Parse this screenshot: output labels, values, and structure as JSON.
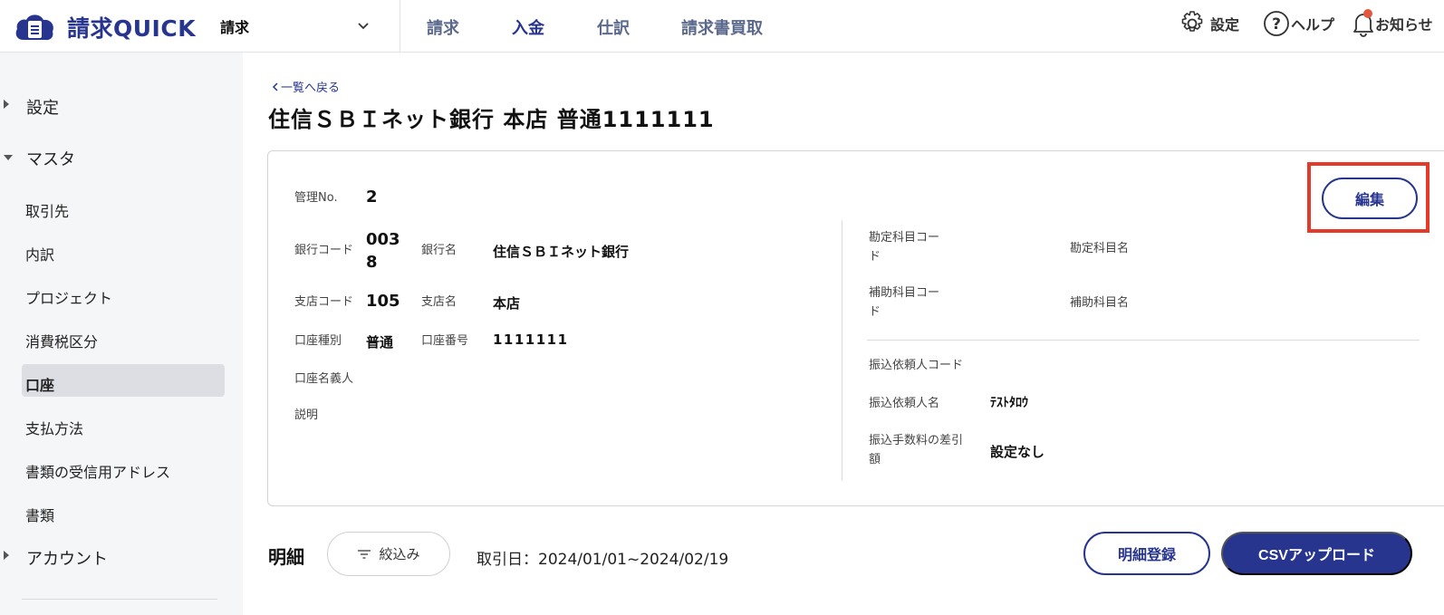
{
  "header": {
    "logo_text": "請求QUICK",
    "app_select": "請求",
    "nav": [
      {
        "label": "請求",
        "active": false
      },
      {
        "label": "入金",
        "active": true
      },
      {
        "label": "仕訳",
        "active": false
      },
      {
        "label": "請求書買取",
        "active": false
      }
    ],
    "settings_label": "設定",
    "help_label": "ヘルプ",
    "notice_label": "お知らせ"
  },
  "sidebar": {
    "groups": {
      "settings": "設定",
      "master": "マスタ",
      "account": "アカウント"
    },
    "items": [
      "取引先",
      "内訳",
      "プロジェクト",
      "消費税区分",
      "口座",
      "支払方法",
      "書類の受信用アドレス",
      "書類"
    ],
    "active_item": "口座"
  },
  "main": {
    "back_link": "一覧へ戻る",
    "title": "住信ＳＢＩネット銀行 本店 普通1111111",
    "edit_label": "編集",
    "fields": {
      "mgmt_no_label": "管理No.",
      "mgmt_no_value": "2",
      "bank_code_label": "銀行コード",
      "bank_code_value_l1": "003",
      "bank_code_value_l2": "8",
      "bank_name_label": "銀行名",
      "bank_name_value": "住信ＳＢＩネット銀行",
      "branch_code_label": "支店コード",
      "branch_code_value": "105",
      "branch_name_label": "支店名",
      "branch_name_value": "本店",
      "acct_type_label": "口座種別",
      "acct_type_value": "普通",
      "acct_no_label": "口座番号",
      "acct_no_value": "1111111",
      "holder_label": "口座名義人",
      "desc_label": "説明",
      "account_code_label_l1": "勘定科目コー",
      "account_code_label_l2": "ド",
      "account_name_label": "勘定科目名",
      "sub_code_label_l1": "補助科目コー",
      "sub_code_label_l2": "ド",
      "sub_name_label": "補助科目名",
      "requester_code_label": "振込依頼人コード",
      "requester_name_label": "振込依頼人名",
      "requester_name_value": "ﾃｽﾄﾀﾛｳ",
      "fee_label_l1": "振込手数料の差引",
      "fee_label_l2": "額",
      "fee_value": "設定なし"
    },
    "detail": {
      "title": "明細",
      "filter_label": "絞込み",
      "date_range": "取引日：2024/01/01~2024/02/19",
      "register_label": "明細登録",
      "csv_label": "CSVアップロード"
    }
  },
  "colors": {
    "brand": "#27358f",
    "highlight": "#e53a2a",
    "sidebar_bg": "#f5f6f8",
    "notification_dot": "#e2583e"
  }
}
